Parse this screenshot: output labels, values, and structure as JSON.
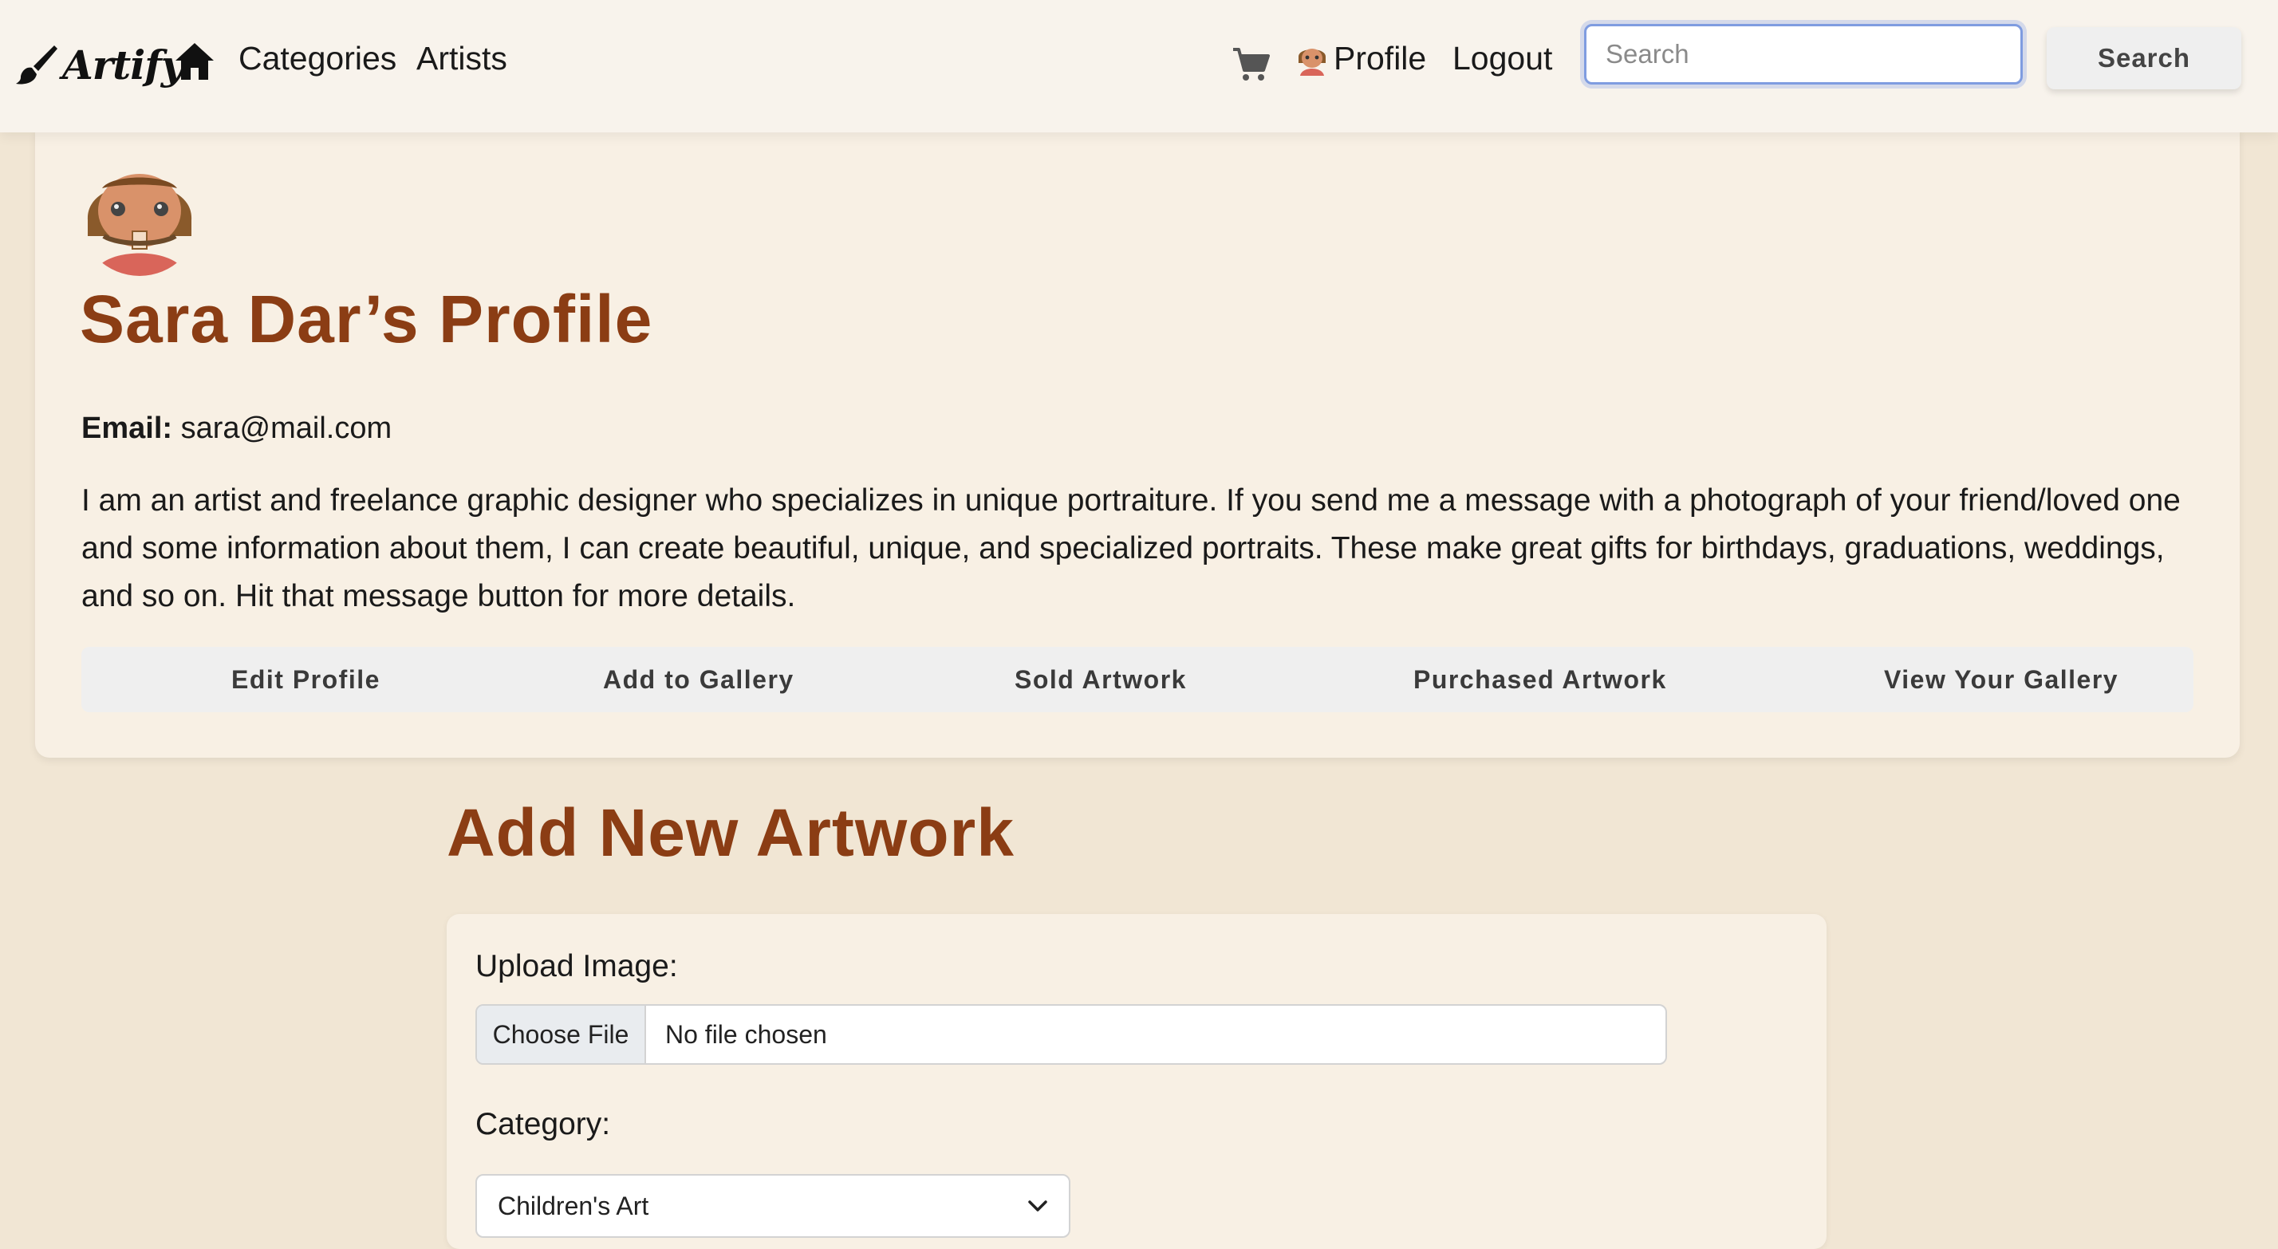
{
  "navbar": {
    "brand": "Artify",
    "links": {
      "categories": "Categories",
      "artists": "Artists",
      "profile": "Profile",
      "logout": "Logout"
    },
    "search": {
      "placeholder": "Search",
      "value": "",
      "button_label": "Search"
    },
    "icons": {
      "brand": "paintbrush-icon",
      "home": "home-icon",
      "cart": "cart-icon",
      "profile": "avatar"
    }
  },
  "profile": {
    "title": "Sara Dar’s Profile",
    "email_label": "Email:",
    "email": "sara@mail.com",
    "bio": "I am an artist and freelance graphic designer who specializes in unique portraiture. If you send me a message with a photograph of your friend/loved one and some information about them, I can create beautiful, unique, and specialized portraits. These make great gifts for birthdays, graduations, weddings, and so on. Hit that message button for more details.",
    "actions": {
      "edit": "Edit Profile",
      "add": "Add to Gallery",
      "sold": "Sold Artwork",
      "purchased": "Purchased Artwork",
      "view": "View Your Gallery"
    }
  },
  "add_artwork": {
    "title": "Add New Artwork",
    "upload_label": "Upload Image:",
    "choose_file_label": "Choose File",
    "file_status": "No file chosen",
    "category_label": "Category:",
    "category_value": "Children's Art"
  },
  "colors": {
    "heading": "#8b3d14",
    "page_bg": "#f1e6d4",
    "card_bg": "#f8f0e4",
    "focus_ring": "#7f9ce0"
  }
}
